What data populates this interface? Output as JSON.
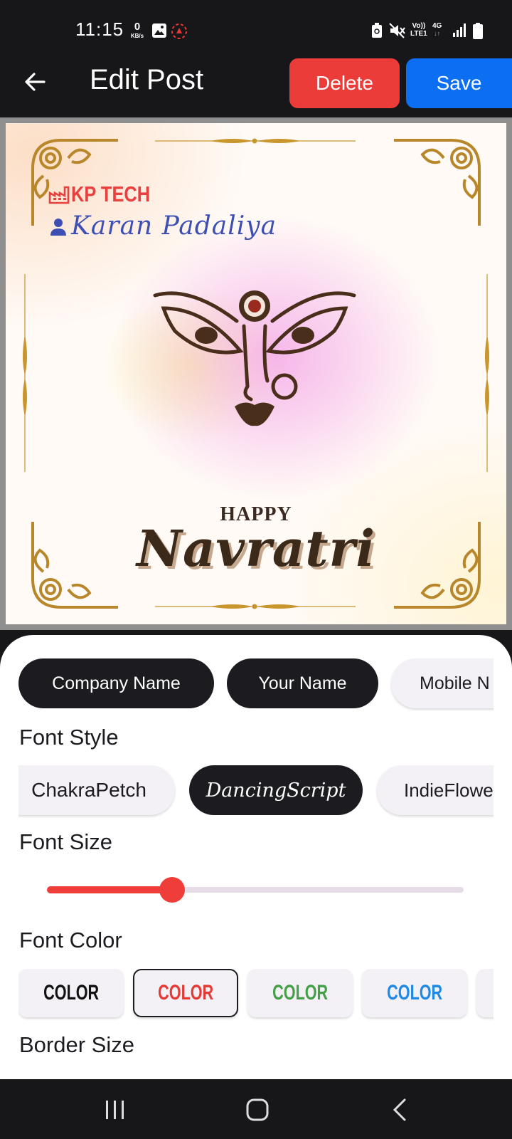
{
  "status_bar": {
    "time": "11:15",
    "data_speed_value": "0",
    "data_speed_unit": "KB/s",
    "network_label_1": "Vo))",
    "network_label_2": "LTE1",
    "network_type": "4G",
    "icons": [
      "gallery-icon",
      "app-notification-icon",
      "battery-saver-icon",
      "mute-icon",
      "signal-icon",
      "battery-icon"
    ]
  },
  "app_bar": {
    "title": "Edit Post",
    "delete_label": "Delete",
    "save_label": "Save",
    "delete_color": "#ec3c3a",
    "save_color": "#0b6ef3"
  },
  "post": {
    "company_name": "KP TECH",
    "person_name": "Karan Padaliya",
    "greeting_small": "HAPPY",
    "greeting_large": "Navratri"
  },
  "field_tabs": [
    {
      "label": "Company Name",
      "selected": true
    },
    {
      "label": "Your Name",
      "selected": true
    },
    {
      "label": "Mobile N",
      "selected": false
    }
  ],
  "font_style": {
    "label": "Font Style",
    "options": [
      {
        "label": "ChakraPetch",
        "selected": false
      },
      {
        "label": "DancingScript",
        "selected": true
      },
      {
        "label": "IndieFlowe",
        "selected": false
      }
    ]
  },
  "font_size": {
    "label": "Font Size",
    "value_fraction": 0.3
  },
  "font_color": {
    "label": "Font Color",
    "options": [
      {
        "label": "COLOR",
        "color": "#111111",
        "selected": false
      },
      {
        "label": "COLOR",
        "color": "#e53935",
        "selected": true
      },
      {
        "label": "COLOR",
        "color": "#43a047",
        "selected": false
      },
      {
        "label": "COLOR",
        "color": "#1e88e5",
        "selected": false
      }
    ]
  },
  "border_size": {
    "label": "Border Size"
  },
  "nav_bar": {
    "icons": [
      "recent-apps-icon",
      "home-icon",
      "back-nav-icon"
    ]
  }
}
